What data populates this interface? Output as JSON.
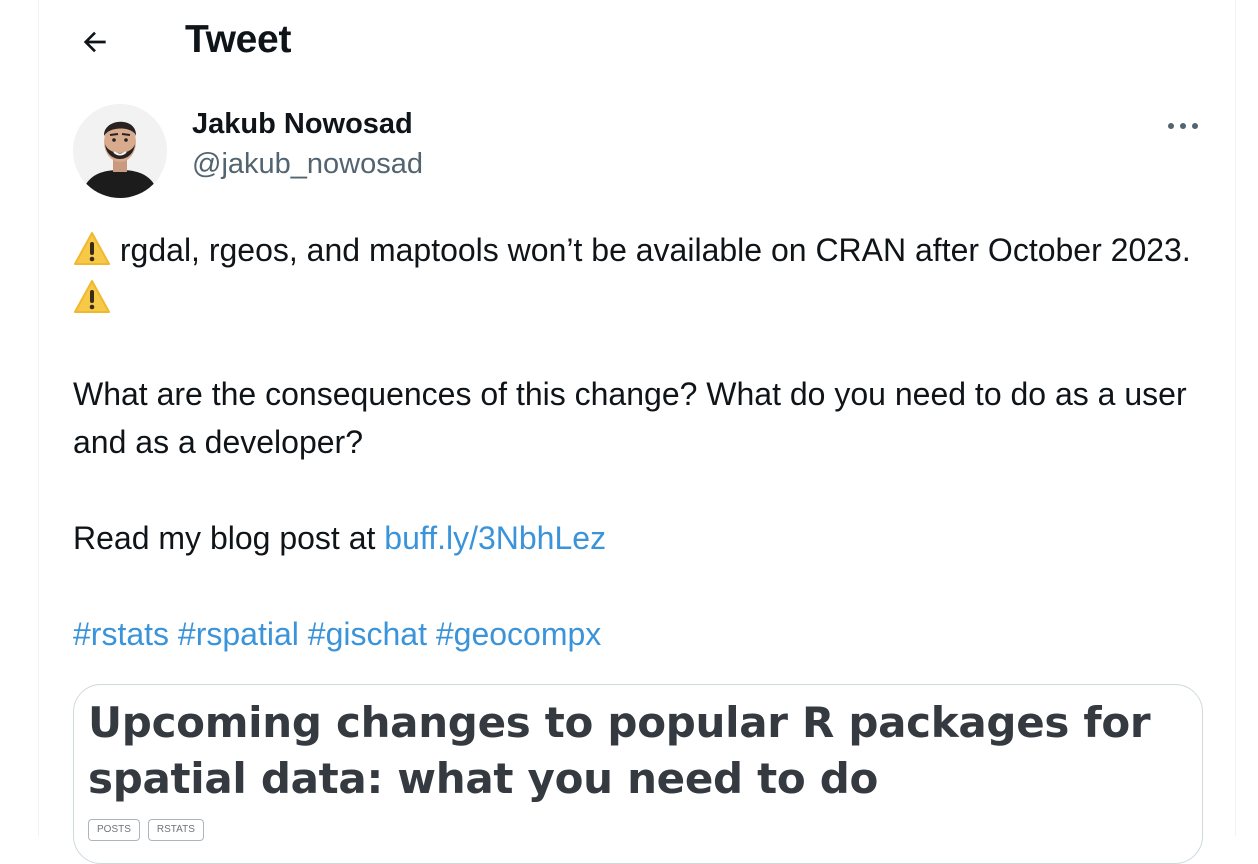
{
  "header": {
    "title": "Tweet",
    "back_icon": "arrow-left-icon"
  },
  "author": {
    "name": "Jakub Nowosad",
    "handle": "@jakub_nowosad",
    "more_icon": "more-horizontal-icon"
  },
  "tweet": {
    "line1": "rgdal, rgeos, and maptools won’t be available on CRAN after October 2023.",
    "line2": "What are the consequences of this change? What do you need to do as a user and as a developer?",
    "read_prefix": "Read my blog post at ",
    "link_text": "buff.ly/3NbhLez",
    "hashtags": [
      "#rstats",
      "#rspatial",
      "#gischat",
      "#geocompx"
    ],
    "warning_icon": "warning-sign-icon"
  },
  "card": {
    "title": "Upcoming changes to popular R packages for spatial data: what you need to do",
    "tags": [
      "POSTS",
      "RSTATS"
    ]
  },
  "colors": {
    "link": "#3b94d9",
    "text": "#0f1419",
    "secondary": "#536471",
    "border": "#cfd9de"
  }
}
